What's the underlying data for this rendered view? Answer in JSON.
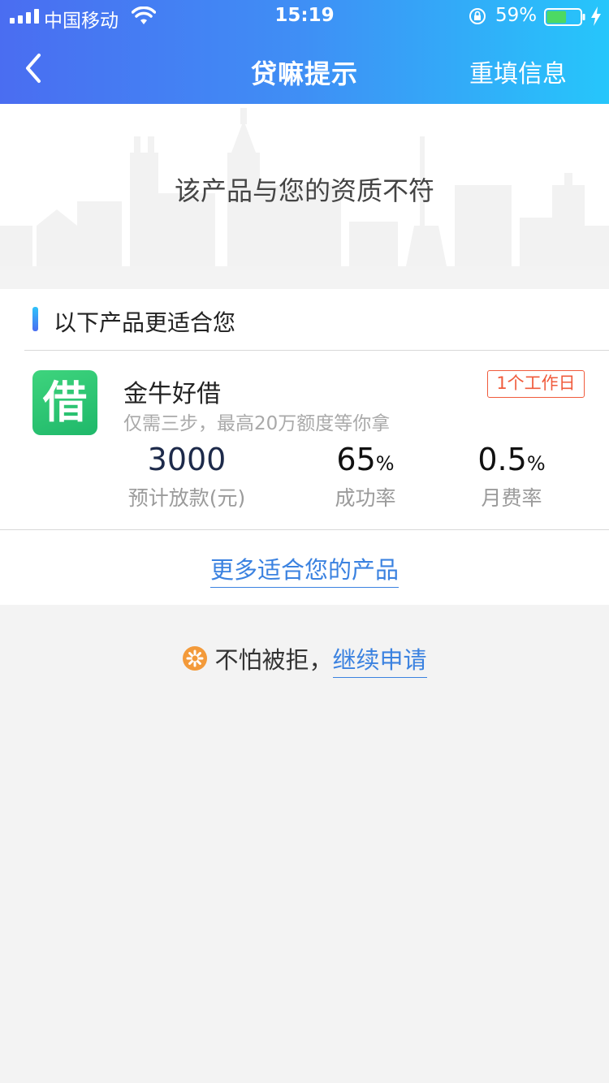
{
  "status_bar": {
    "carrier": "中国移动",
    "time": "15:19",
    "battery_percent": "59%",
    "battery_level": 0.59
  },
  "nav": {
    "title": "贷嘛提示",
    "right_action": "重填信息"
  },
  "hero": {
    "message": "该产品与您的资质不符"
  },
  "recommend": {
    "title": "以下产品更适合您"
  },
  "product": {
    "logo_char": "借",
    "name": "金牛好借",
    "description": "仅需三步，最高20万额度等你拿",
    "badge": "1个工作日",
    "stats": [
      {
        "value": "3000",
        "unit": "",
        "label": "预计放款(元)"
      },
      {
        "value": "65",
        "unit": "%",
        "label": "成功率"
      },
      {
        "value": "0.5",
        "unit": "%",
        "label": "月费率"
      }
    ]
  },
  "more_link": "更多适合您的产品",
  "footer": {
    "text": "不怕被拒，",
    "link": "继续申请"
  },
  "colors": {
    "accent": "#3b82e0",
    "badge": "#f05b3c",
    "logo_green": "#2ec872",
    "header_start": "#4a6df1",
    "header_end": "#26c6fb"
  }
}
